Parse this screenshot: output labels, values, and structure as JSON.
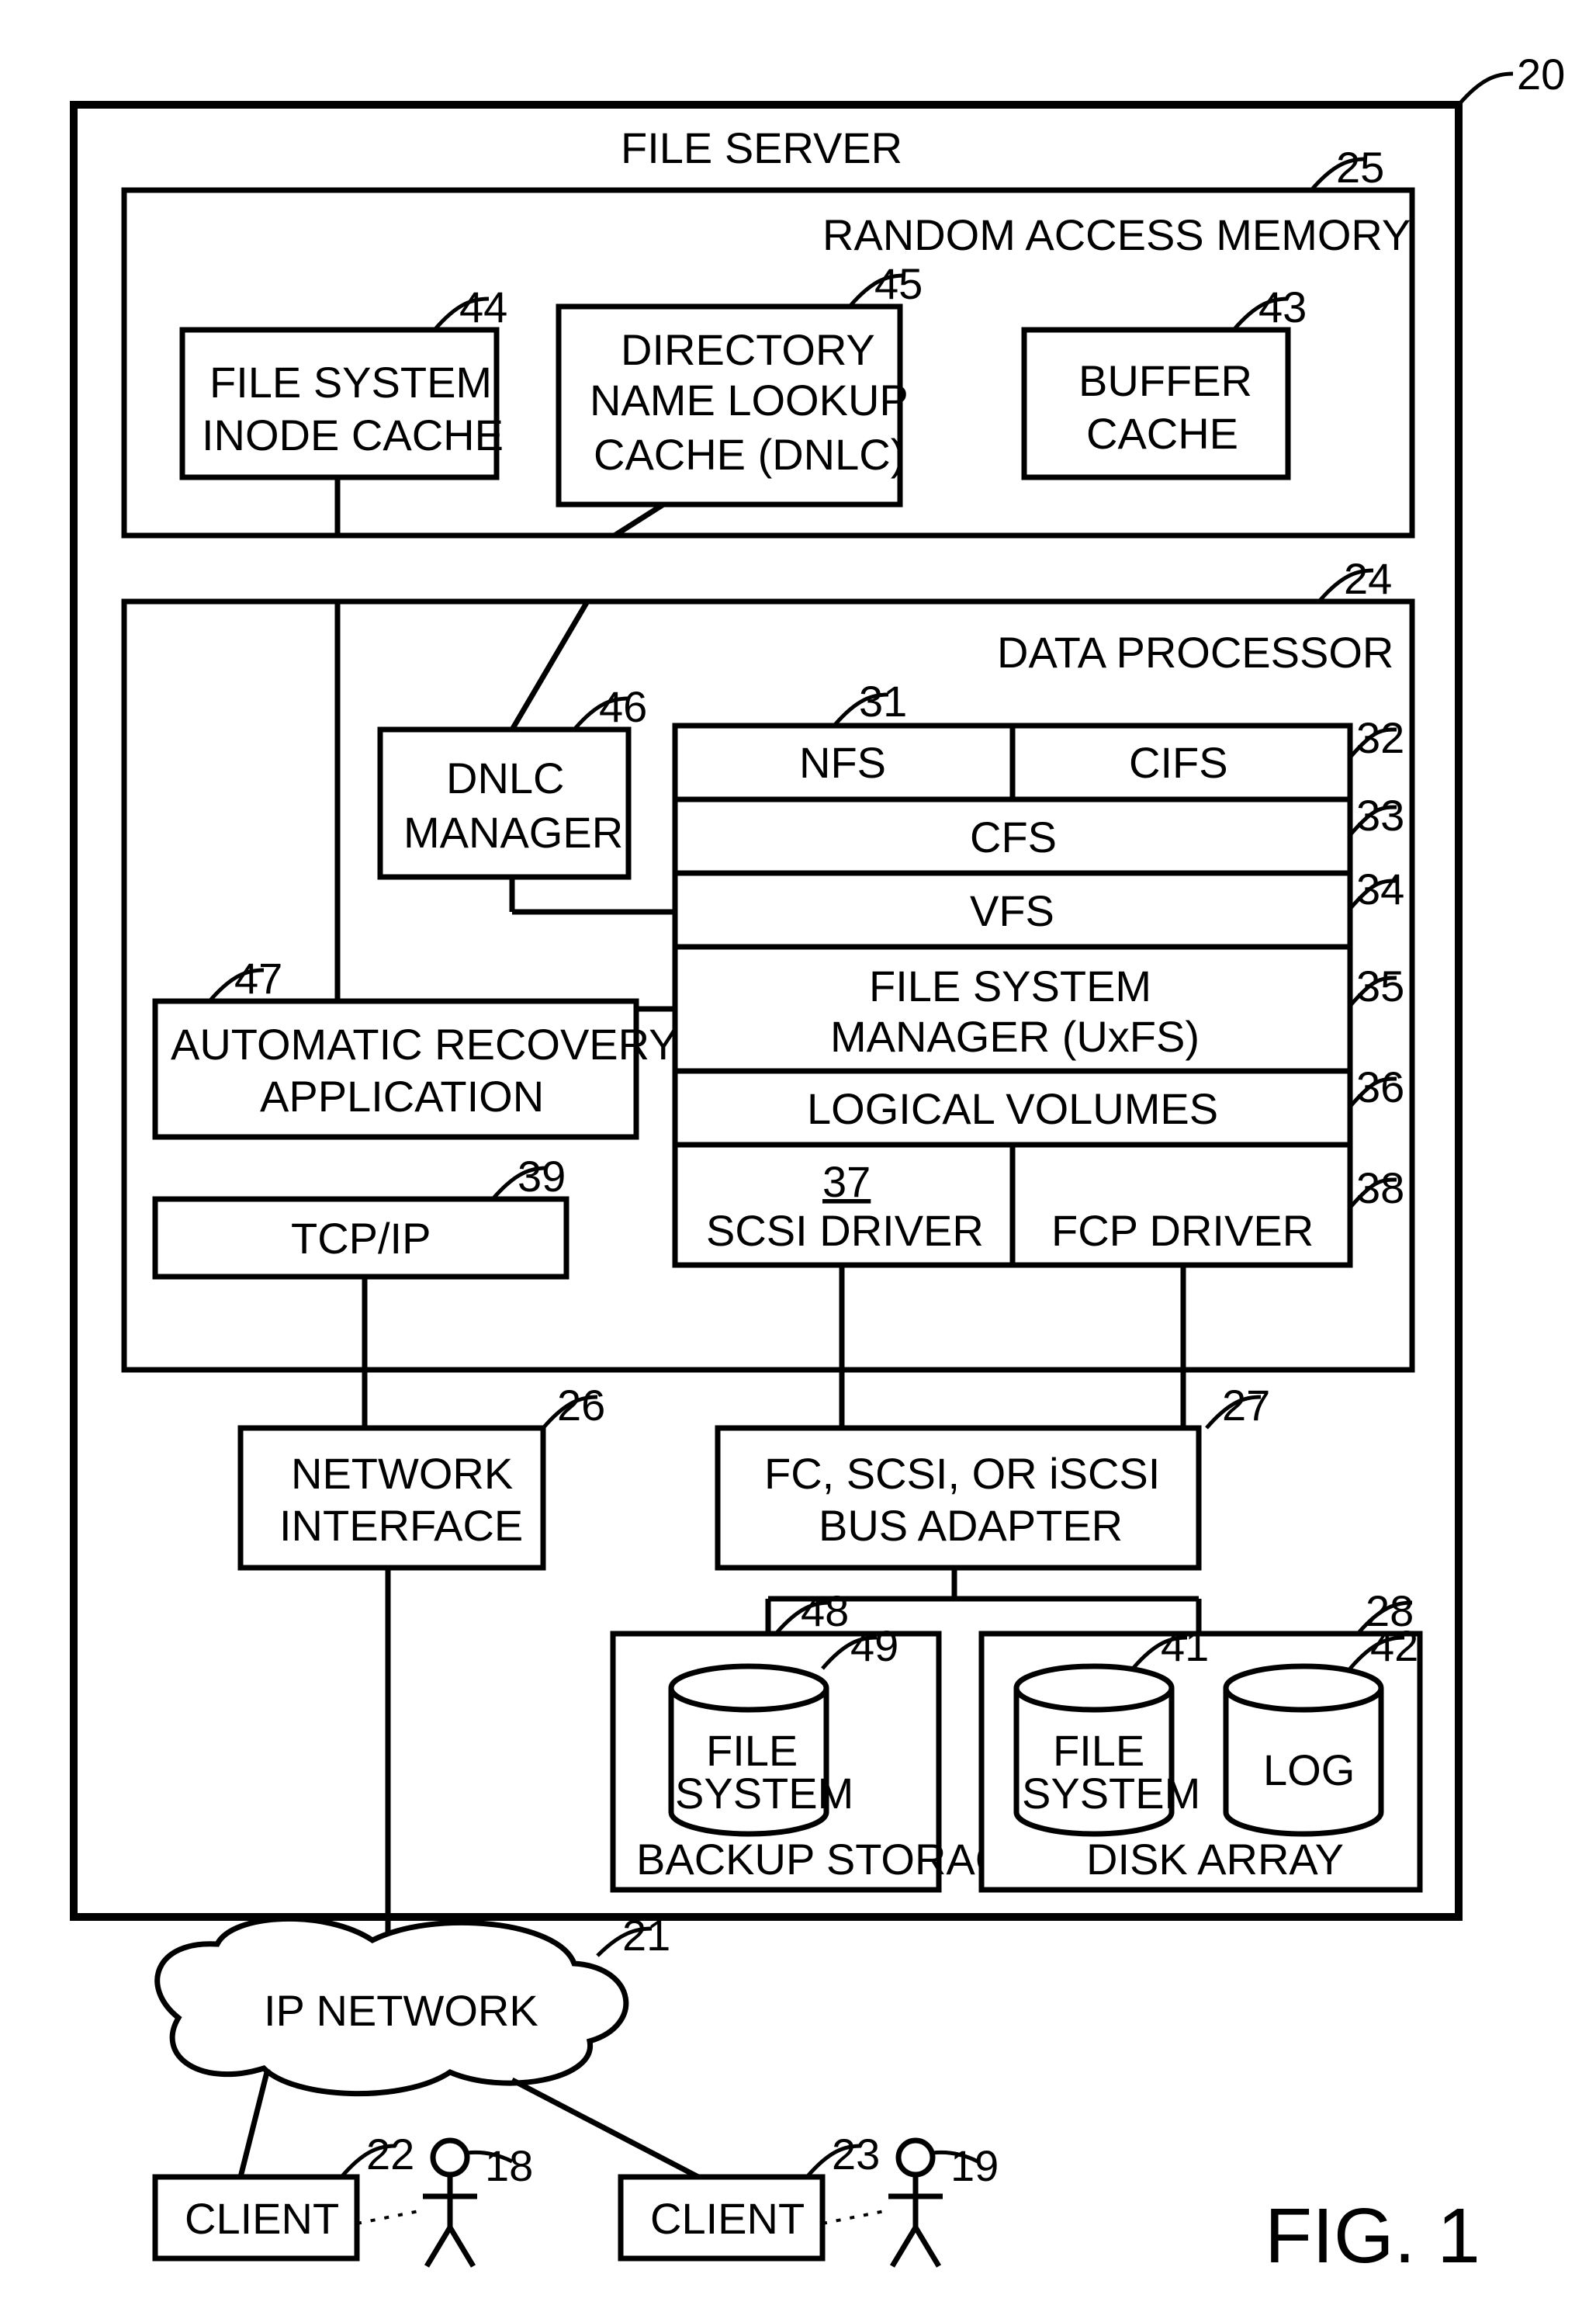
{
  "figure_label": "FIG. 1",
  "refs": {
    "file_server": "20",
    "ram": "25",
    "inode_cache": "44",
    "dnlc": "45",
    "buffer_cache": "43",
    "data_processor": "24",
    "dnlc_manager": "46",
    "nfs": "31",
    "cifs": "32",
    "cfs": "33",
    "vfs": "34",
    "uxfs": "35",
    "logical_volumes": "36",
    "scsi_driver": "37",
    "fcp_driver": "38",
    "tcpip": "39",
    "auto_recovery": "47",
    "network_interface": "26",
    "bus_adapter": "27",
    "backup_storage": "48",
    "backup_fs": "49",
    "disk_array": "28",
    "da_fs": "41",
    "da_log": "42",
    "ip_network": "21",
    "client1": "22",
    "client2": "23",
    "user1": "18",
    "user2": "19"
  },
  "labels": {
    "file_server": "FILE SERVER",
    "ram": "RANDOM ACCESS MEMORY",
    "inode_cache_l1": "FILE SYSTEM",
    "inode_cache_l2": "INODE CACHE",
    "dnlc_l1": "DIRECTORY",
    "dnlc_l2": "NAME LOOKUP",
    "dnlc_l3": "CACHE (DNLC)",
    "buffer_cache_l1": "BUFFER",
    "buffer_cache_l2": "CACHE",
    "data_processor": "DATA PROCESSOR",
    "dnlc_manager_l1": "DNLC",
    "dnlc_manager_l2": "MANAGER",
    "nfs": "NFS",
    "cifs": "CIFS",
    "cfs": "CFS",
    "vfs": "VFS",
    "uxfs_l1": "FILE SYSTEM",
    "uxfs_l2": "MANAGER (UxFS)",
    "logical_volumes": "LOGICAL VOLUMES",
    "scsi_driver": "SCSI DRIVER",
    "fcp_driver": "FCP DRIVER",
    "auto_recovery_l1": "AUTOMATIC RECOVERY",
    "auto_recovery_l2": "APPLICATION",
    "tcpip": "TCP/IP",
    "network_interface_l1": "NETWORK",
    "network_interface_l2": "INTERFACE",
    "bus_adapter_l1": "FC, SCSI, OR iSCSI",
    "bus_adapter_l2": "BUS ADAPTER",
    "backup_storage": "BACKUP STORAGE",
    "backup_fs_l1": "FILE",
    "backup_fs_l2": "SYSTEM",
    "disk_array": "DISK ARRAY",
    "da_fs_l1": "FILE",
    "da_fs_l2": "SYSTEM",
    "da_log": "LOG",
    "ip_network": "IP NETWORK",
    "client1": "CLIENT",
    "client2": "CLIENT"
  }
}
